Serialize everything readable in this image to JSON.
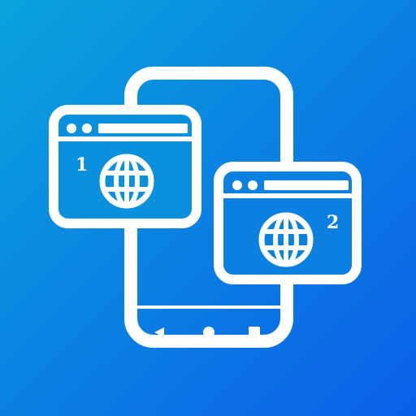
{
  "icon": {
    "name": "multi-browser-phone-icon",
    "colors": {
      "background_start": "#0aa0e0",
      "background_end": "#0b5fe8",
      "foreground": "#ffffff"
    },
    "windows": [
      {
        "number": "1",
        "icon": "globe-icon"
      },
      {
        "number": "2",
        "icon": "globe-icon"
      }
    ],
    "phone_nav": [
      "back-icon",
      "home-icon",
      "recents-icon"
    ]
  }
}
